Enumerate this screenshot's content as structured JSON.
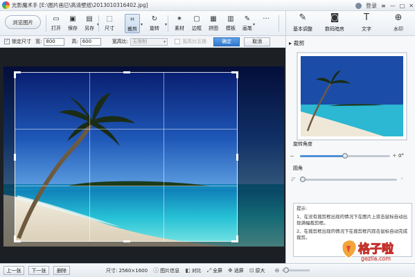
{
  "titlebar": {
    "title": "光影魔术手 [E:\\图片画已\\高清壁纸\\2013010316402.jpg]",
    "login": "登录"
  },
  "toolbar": {
    "browse": "浏览图片",
    "tools": [
      {
        "label": "打开",
        "icon": "folder-open-icon",
        "glyph": "▭"
      },
      {
        "label": "保存",
        "icon": "save-icon",
        "glyph": "▣"
      },
      {
        "label": "另存",
        "icon": "save-as-icon",
        "glyph": "▤"
      },
      {
        "label": "尺寸",
        "icon": "resize-icon",
        "glyph": "⬚"
      },
      {
        "label": "裁剪",
        "icon": "crop-icon",
        "glyph": "⌗"
      },
      {
        "label": "旋转",
        "icon": "rotate-icon",
        "glyph": "↻"
      },
      {
        "label": "素材",
        "icon": "star-icon",
        "glyph": "✶"
      },
      {
        "label": "边框",
        "icon": "border-icon",
        "glyph": "▢"
      },
      {
        "label": "拼图",
        "icon": "collage-icon",
        "glyph": "▦"
      },
      {
        "label": "模板",
        "icon": "template-icon",
        "glyph": "▥"
      },
      {
        "label": "画笔",
        "icon": "brush-icon",
        "glyph": "✎"
      },
      {
        "label": "",
        "icon": "more-icon",
        "glyph": "···"
      }
    ]
  },
  "right_tools": [
    {
      "label": "基本调整",
      "icon": "adjust-icon",
      "glyph": "✎"
    },
    {
      "label": "数码暗房",
      "icon": "darkroom-icon",
      "glyph": "◙"
    },
    {
      "label": "文字",
      "icon": "text-icon",
      "glyph": "T"
    },
    {
      "label": "水印",
      "icon": "watermark-icon",
      "glyph": "⊕"
    }
  ],
  "optbar": {
    "lock_label": "锁定尺寸",
    "width_label": "宽:",
    "width_value": "800",
    "height_label": "高:",
    "height_value": "600",
    "ratio_label": "宽高比:",
    "ratio_value": "无限制",
    "swap_label": "宽高比互换",
    "confirm": "确定",
    "cancel": "取消"
  },
  "panel": {
    "title": "裁剪",
    "rotate_label": "旋转角度",
    "rotate_value": "0°",
    "rotate_fraction": 0.5,
    "round_label": "圆角",
    "round_fraction": 0.03,
    "tip_title": "提示:",
    "tip_1": "1、在没有裁剪框出现的情况下在图片上双击鼠标自动出现满幅裁剪框。",
    "tip_2": "2、在裁剪框出现的情况下在裁剪框内双击鼠标自动完成裁剪。"
  },
  "statusbar": {
    "prev": "上一张",
    "next": "下一张",
    "delete": "删除",
    "size": "尺寸: 2560×1600",
    "info": "图片信息",
    "compare": "对比",
    "fullscreen": "全屏",
    "fit": "适屏",
    "original": "原大"
  },
  "watermark": {
    "text": "格子啦",
    "url": "gezila.com"
  }
}
